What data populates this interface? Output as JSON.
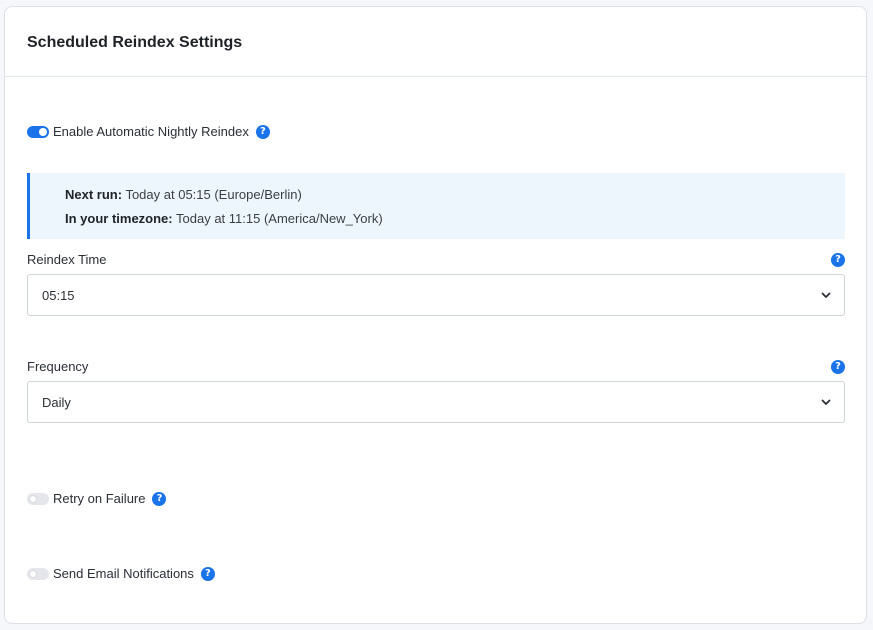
{
  "card": {
    "title": "Scheduled Reindex Settings"
  },
  "nightly_toggle": {
    "label": "Enable Automatic Nightly Reindex",
    "checked": true
  },
  "info": {
    "next_run_label": "Next run:",
    "next_run_value": "Today at 05:15 (Europe/Berlin)",
    "timezone_label": "In your timezone:",
    "timezone_value": "Today at 11:15 (America/New_York)"
  },
  "reindex_time": {
    "label": "Reindex Time",
    "value": "05:15"
  },
  "frequency": {
    "label": "Frequency",
    "value": "Daily"
  },
  "retry_toggle": {
    "label": "Retry on Failure",
    "checked": false
  },
  "email_toggle": {
    "label": "Send Email Notifications",
    "checked": false
  },
  "help_glyph": "?",
  "colors": {
    "accent": "#1a73e8",
    "info_bg": "#eef6fd"
  }
}
